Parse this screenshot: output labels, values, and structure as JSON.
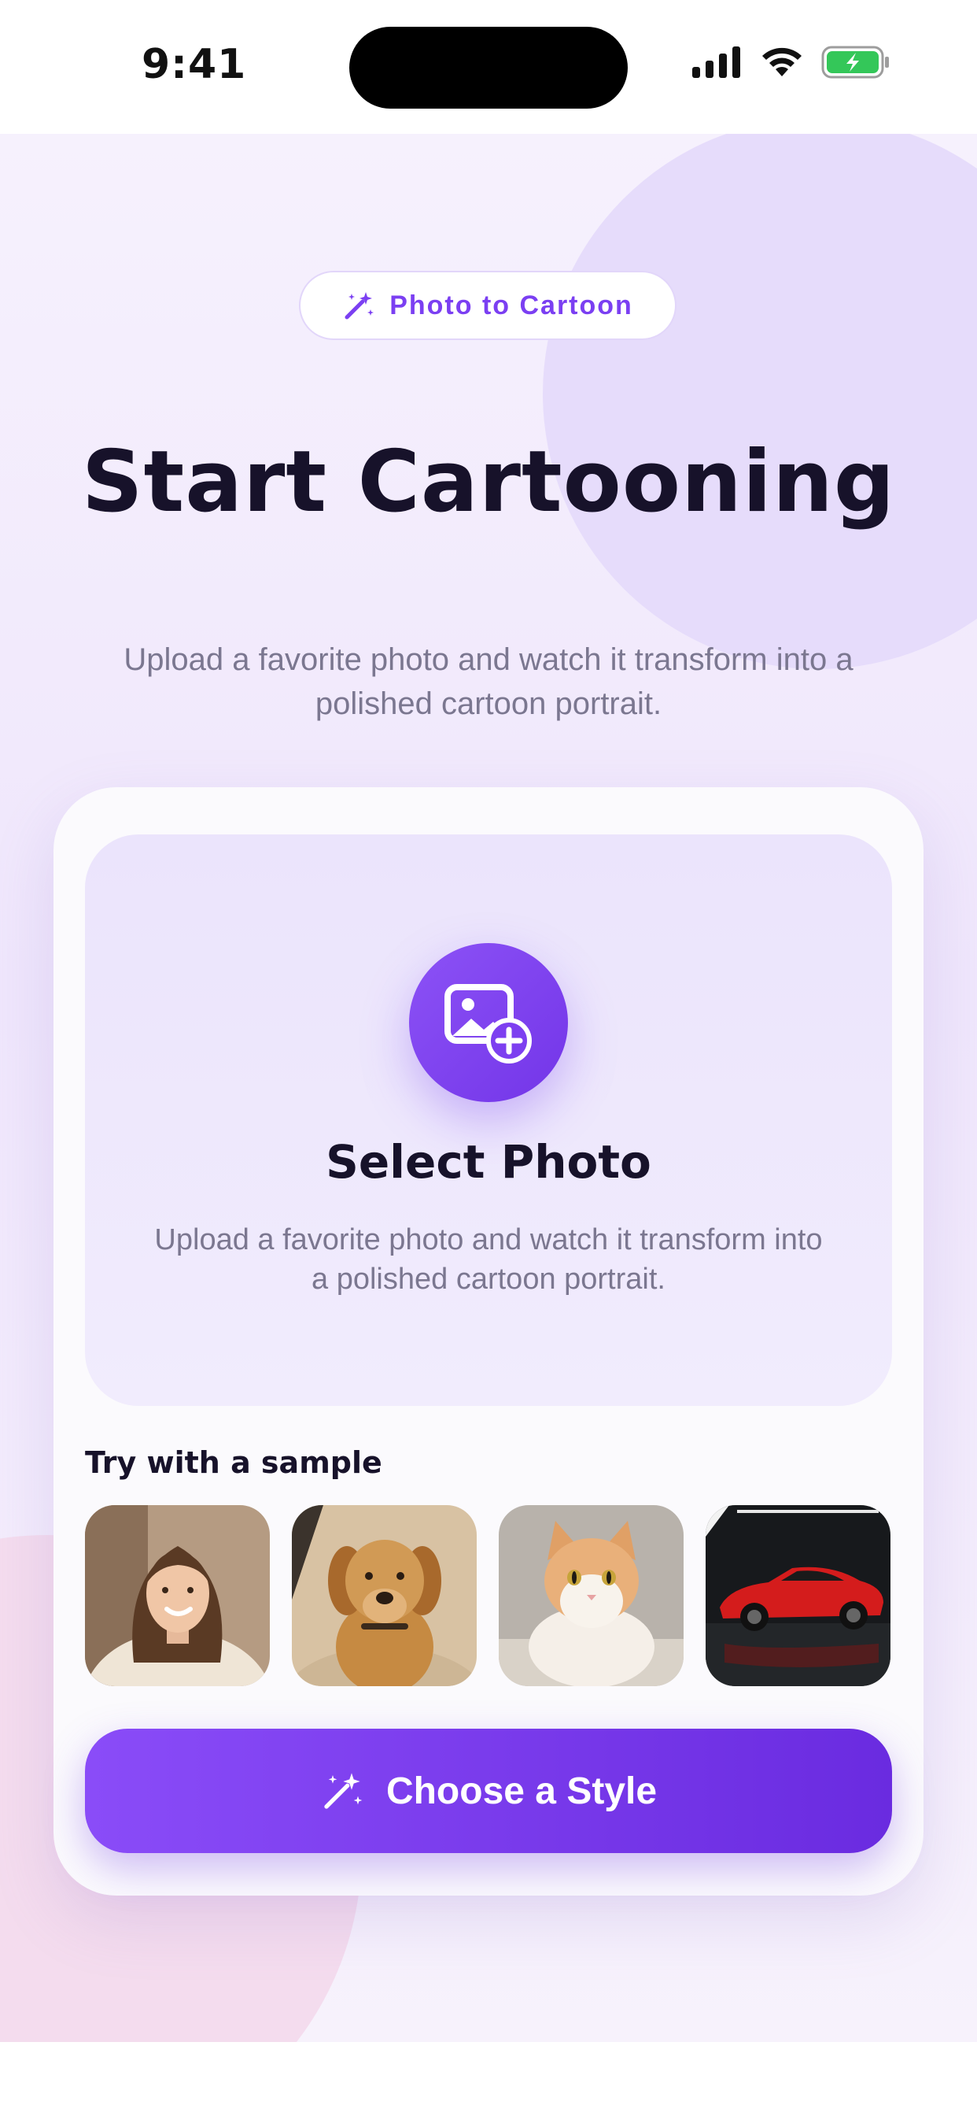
{
  "status_bar": {
    "time": "9:41"
  },
  "header": {
    "badge_label": "Photo to Cartoon",
    "badge_icon": "magic-wand-icon",
    "title": "Start Cartooning",
    "subtitle": "Upload a favorite photo and watch it transform into a polished cartoon portrait."
  },
  "upload": {
    "icon": "image-plus-icon",
    "title": "Select Photo",
    "subtitle": "Upload a favorite photo and watch it transform into a polished cartoon portrait."
  },
  "samples": {
    "label": "Try with a sample",
    "items": [
      "woman-portrait",
      "golden-retriever",
      "cat",
      "red-sports-car"
    ]
  },
  "cta": {
    "label": "Choose a Style",
    "icon": "magic-wand-icon"
  },
  "colors": {
    "accent": "#7b3ff2",
    "title": "#17122a",
    "muted": "#7b7790"
  }
}
